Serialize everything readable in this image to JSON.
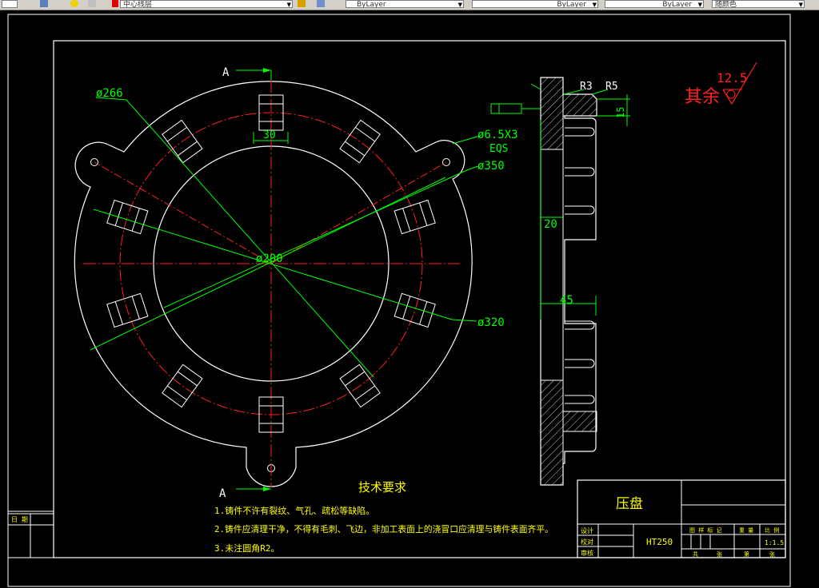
{
  "toolbar": {
    "layer_value": "中心线层",
    "color_value": "ByLayer",
    "linetype_value": "ByLayer",
    "lineweight_value": "ByLayer",
    "plotstyle_value": "随颜色"
  },
  "drawing": {
    "section_label_top": "A",
    "section_label_bottom": "A",
    "dims": {
      "d266": "ø266",
      "slot_width": "30",
      "holes": "ø6.5X3",
      "eqs": "EQS",
      "d350": "ø350",
      "d200": "ø200",
      "d320": "ø320",
      "r3": "R3",
      "r5": "R5",
      "h15": "15",
      "h20": "20",
      "w45": "45"
    },
    "roughness": {
      "label": "其余",
      "value": "12.5"
    },
    "tech_req": {
      "title": "技术要求",
      "items": [
        "1.铸件不许有裂纹、气孔、疏松等缺陷。",
        "2.铸件应清理干净，不得有毛刺、飞边，非加工表面上的浇冒口应清理与铸件表面齐平。",
        "3.未注圆角R2。"
      ]
    },
    "title_block": {
      "part_name": "压盘",
      "material": "HT250",
      "designer_label": "设计",
      "checker_label": "校对",
      "approver_label": "审核",
      "col_headers": [
        "图 样 标 记",
        "重 量",
        "比 例"
      ],
      "scale": "1:1.5",
      "footer": [
        "共",
        "张",
        "第",
        "张"
      ]
    },
    "side_label": "日 期",
    "colors": {
      "outline": "#ffffff",
      "center": "#ff2020",
      "dim": "#00ff00",
      "text_red": "#ff2020",
      "text_yellow": "#ffff00"
    }
  }
}
